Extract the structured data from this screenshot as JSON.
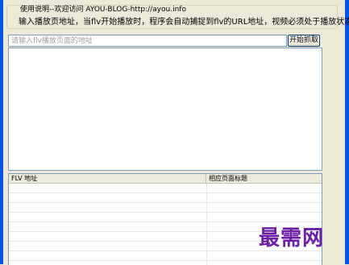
{
  "group": {
    "legend": "使用说明--欢迎访问 AYOU-BLOG-http://ayou.info",
    "description": "输入播放页地址，当flv开始播放时，程序会自动捕捉到flv的URL地址，视频必须处于播放状态"
  },
  "url_input": {
    "value": "",
    "placeholder": "请输入flv播放页面的地址"
  },
  "start_button": {
    "label": "开始抓取"
  },
  "listview": {
    "columns": [
      "FLV 地址",
      "相应页面标题"
    ],
    "rows": []
  },
  "watermark": {
    "text": "最需网"
  },
  "colors": {
    "window_frame": "#0055e5",
    "background": "#ece9d8",
    "watermark": "#6b1fa2"
  }
}
